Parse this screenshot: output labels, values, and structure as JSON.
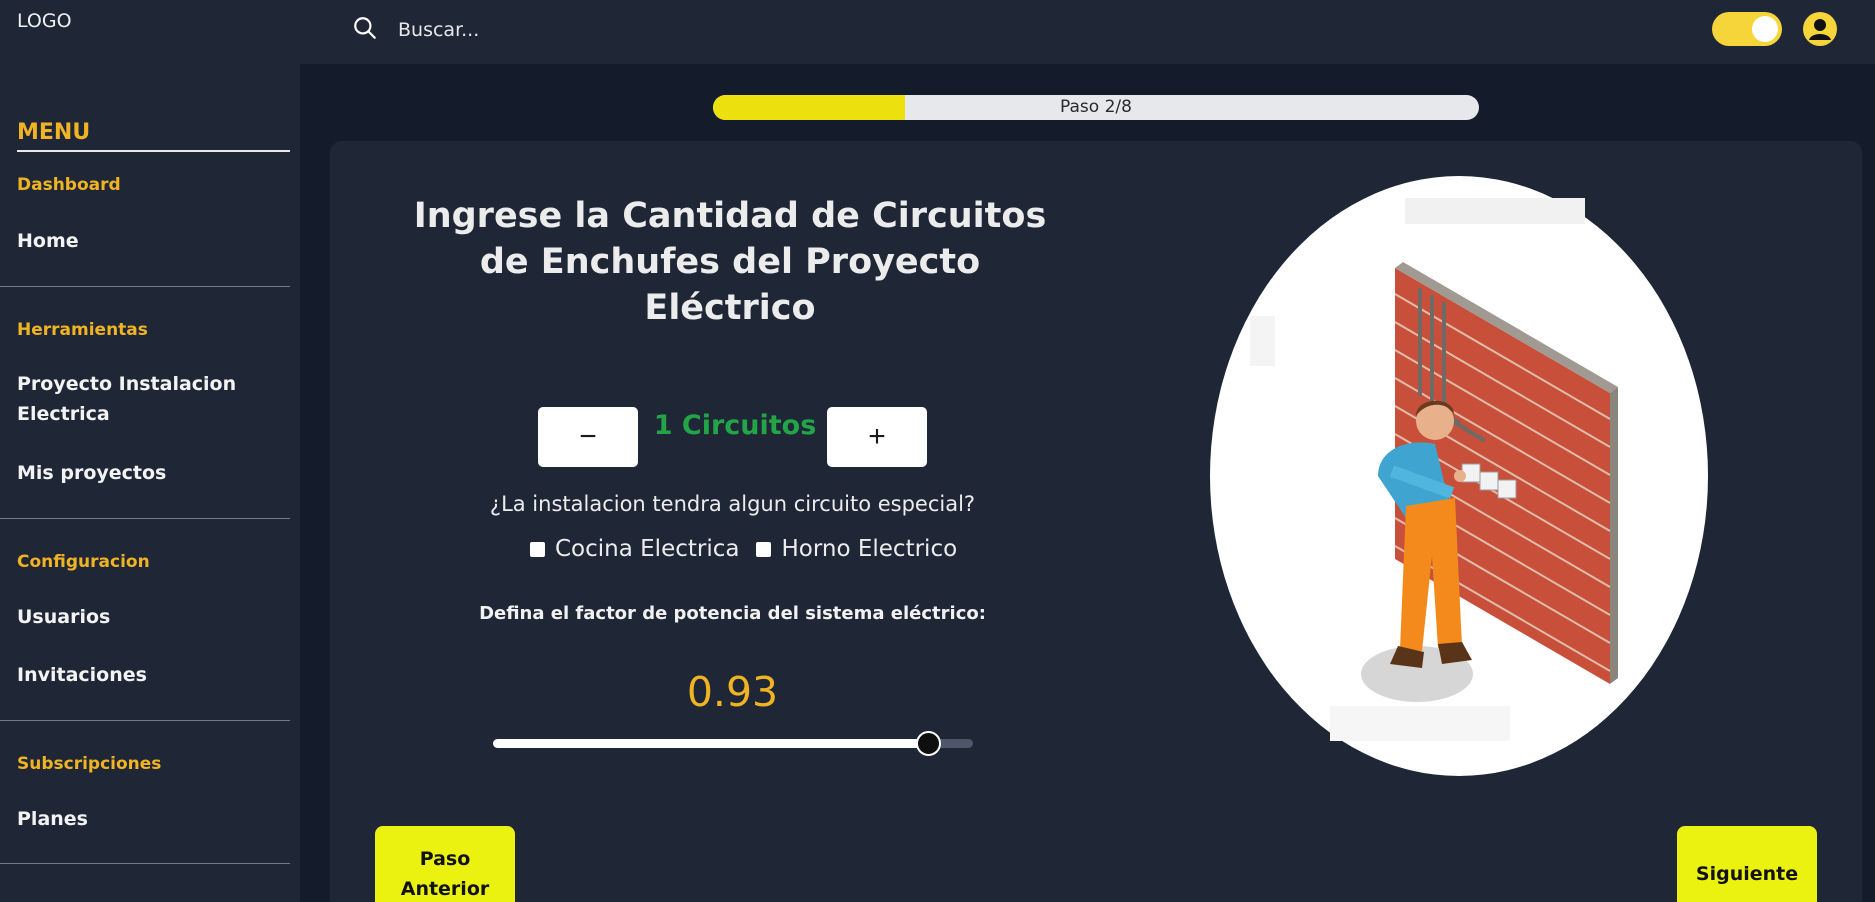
{
  "header": {
    "logo": "LOGO",
    "search_placeholder": "Buscar...",
    "theme_toggle_on": true
  },
  "sidebar": {
    "menu_title": "MENU",
    "sections": [
      {
        "label": "Dashboard",
        "items": [
          "Home"
        ]
      },
      {
        "label": "Herramientas",
        "items": [
          "Proyecto Instalacion Electrica",
          "Mis proyectos"
        ]
      },
      {
        "label": "Configuracion",
        "items": [
          "Usuarios",
          "Invitaciones"
        ]
      },
      {
        "label": "Subscripciones",
        "items": [
          "Planes"
        ]
      }
    ]
  },
  "progress": {
    "label": "Paso 2/8",
    "fraction": 0.25
  },
  "main": {
    "heading": "Ingrese la Cantidad de Circuitos de Enchufes del Proyecto Eléctrico",
    "minus_symbol": "−",
    "plus_symbol": "+",
    "circuit_count": "1 Circuitos",
    "special_question": "¿La instalacion tendra algun circuito especial?",
    "options": [
      "Cocina Electrica",
      "Horno Electrico"
    ],
    "power_factor_label": "Defina el factor de potencia del sistema eléctrico:",
    "power_factor_value": "0.93",
    "power_factor_level": 0.93
  },
  "navigation": {
    "prev_label": "Paso Anterior",
    "next_label": "Siguiente"
  },
  "colors": {
    "accent_yellow": "#f0b323",
    "count_green": "#22a447",
    "button_yellow": "#ecf20f",
    "background": "#141c2b",
    "panel": "#1f2737"
  }
}
